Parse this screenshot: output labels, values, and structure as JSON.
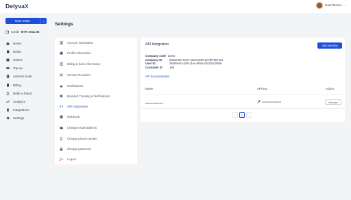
{
  "app": {
    "logo_main": "Delyva",
    "logo_accent": "X"
  },
  "user": {
    "name": "Hanif Demo",
    "chevron": "⌄",
    "avatar_icon": "avatar"
  },
  "sidebar": {
    "new_order_label": "New Order",
    "new_order_dropdown": "⌄",
    "credit_label": "Credit",
    "credit_amount": "MYR 2511.08",
    "items": [
      {
        "label": "Home",
        "icon": "home-icon"
      },
      {
        "label": "Drafts",
        "icon": "drafts-icon"
      },
      {
        "label": "Orders",
        "icon": "orders-icon"
      },
      {
        "label": "Top-up",
        "icon": "topup-icon"
      },
      {
        "label": "Address book",
        "icon": "address-book-icon"
      },
      {
        "label": "Billing",
        "icon": "billing-icon"
      },
      {
        "label": "Refer a friend",
        "icon": "refer-icon"
      },
      {
        "label": "Analytics",
        "icon": "analytics-icon"
      },
      {
        "label": "Integrations",
        "icon": "integrations-icon"
      },
      {
        "label": "Settings",
        "icon": "settings-icon"
      }
    ]
  },
  "page": {
    "title": "Settings"
  },
  "settings_menu": {
    "items": [
      {
        "label": "Account information"
      },
      {
        "label": "Profile information"
      },
      {
        "label": "Billing & bank information"
      },
      {
        "label": "Service Providers"
      },
      {
        "label": "Notifications"
      },
      {
        "label": "Branded Tracking & Notifications"
      },
      {
        "label": "API Integrations"
      },
      {
        "label": "Webhook"
      },
      {
        "label": "Change email address"
      },
      {
        "label": "Change phone number"
      },
      {
        "label": "Change password"
      },
      {
        "label": "Logout"
      }
    ],
    "active_index": 6
  },
  "api": {
    "title": "API Integration",
    "add_key_label": "Add new key",
    "company_code_label": "Company code",
    "company_code": "demo",
    "company_id_label": "Company ID",
    "company_id": "9a0ae46e-5c67-42a4-82b6-a07bf7887151",
    "user_id_label": "User ID",
    "user_id": "2605fea0-c195-11ea-8b8a-3f1f1b2d2688",
    "customer_id_label": "Customer ID",
    "customer_id": "199",
    "doc_link": "API documentation",
    "columns": {
      "name": "Name",
      "key": "API key",
      "action": "Action"
    },
    "rows": [
      {
        "name": "woocommerce",
        "key": "••••••••••••••••••••",
        "action": "Revoke"
      }
    ],
    "pager": {
      "prev": "‹",
      "page": "1",
      "next": "›"
    }
  },
  "colors": {
    "accent": "#1d4ed8",
    "danger": "#dc2626",
    "background": "#f3f4f6"
  }
}
